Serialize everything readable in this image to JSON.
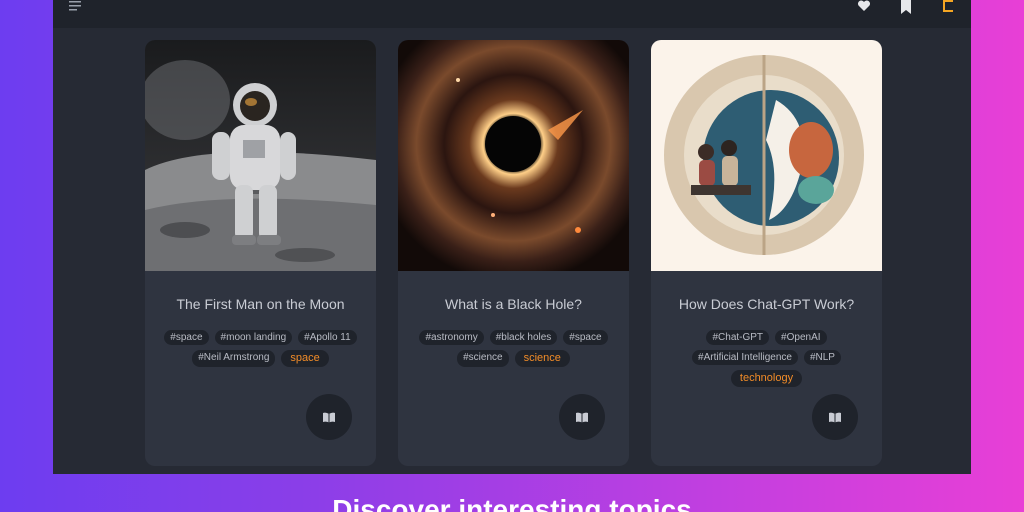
{
  "header": {
    "icons": [
      "menu-icon",
      "heart-icon",
      "bookmark-icon",
      "brand-icon"
    ],
    "brand_color": "#f5a623"
  },
  "cards": [
    {
      "image": "astronaut-on-moon-image",
      "title": "The First Man on the Moon",
      "tags": [
        "#space",
        "#moon landing",
        "#Apollo 11",
        "#Neil Armstrong"
      ],
      "category": "space"
    },
    {
      "image": "black-hole-image",
      "title": "What is a Black Hole?",
      "tags": [
        "#astronomy",
        "#black holes",
        "#space",
        "#science"
      ],
      "category": "science"
    },
    {
      "image": "split-globe-people-image",
      "title": "How Does Chat-GPT Work?",
      "tags": [
        "#Chat-GPT",
        "#OpenAI",
        "#Artificial Intelligence",
        "#NLP"
      ],
      "category": "technology"
    }
  ],
  "colors": {
    "category_accent": "#f28c28",
    "card_bg": "#2f3440",
    "app_bg": "#262a34"
  },
  "headline": "Discover interesting topics"
}
